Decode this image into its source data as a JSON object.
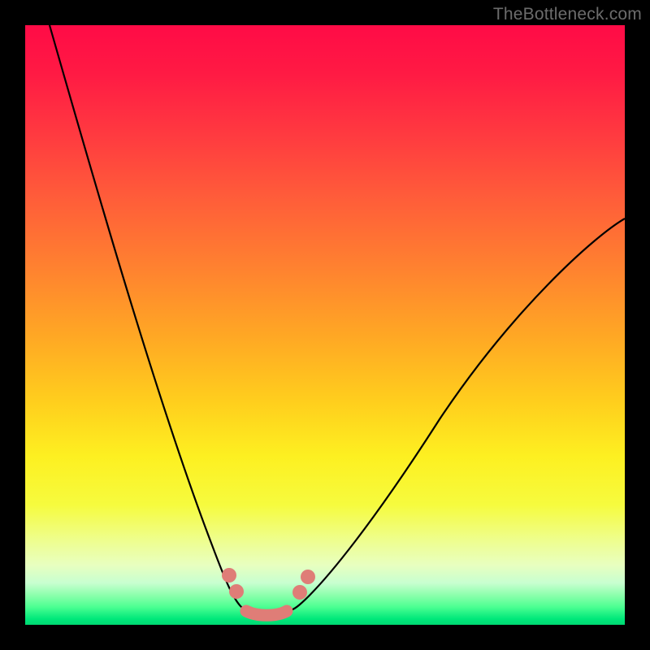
{
  "watermark": "TheBottleneck.com",
  "chart_data": {
    "type": "line",
    "title": "",
    "xlabel": "",
    "ylabel": "",
    "xlim": [
      0,
      100
    ],
    "ylim": [
      0,
      100
    ],
    "grid": false,
    "legend": false,
    "background": "rainbow_gradient_red_top_green_bottom",
    "series": [
      {
        "name": "bottleneck-curve",
        "x": [
          0,
          5,
          10,
          15,
          20,
          25,
          28,
          31,
          33,
          35,
          36,
          38,
          40,
          42,
          44,
          47,
          52,
          58,
          65,
          73,
          82,
          91,
          100
        ],
        "y": [
          100,
          88,
          76,
          63,
          49,
          34,
          24,
          14,
          8,
          4,
          2,
          0,
          0,
          0,
          2,
          6,
          12,
          20,
          29,
          38,
          48,
          57,
          65
        ]
      }
    ],
    "highlight": {
      "name": "optimal-range-marker",
      "color": "#df7d77",
      "x_range": [
        33,
        47
      ],
      "y": 1
    },
    "annotations": []
  },
  "colors": {
    "frame": "#000000",
    "curve": "#000000",
    "highlight": "#df7d77",
    "watermark": "#6c6c6c"
  }
}
